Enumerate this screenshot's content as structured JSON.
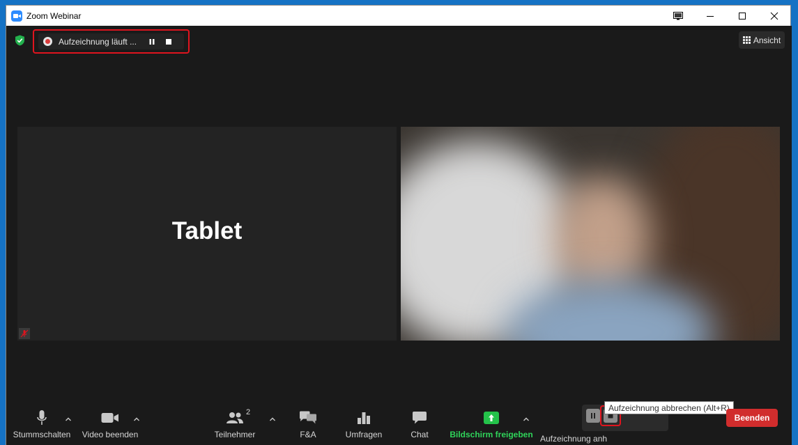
{
  "window": {
    "title": "Zoom Webinar"
  },
  "recording": {
    "status_text": "Aufzeichnung läuft ..."
  },
  "view": {
    "label": "Ansicht"
  },
  "tiles": {
    "left_name": "Tablet"
  },
  "toolbar": {
    "mute_label": "Stummschalten",
    "video_label": "Video beenden",
    "participants_label": "Teilnehmer",
    "participants_count": "2",
    "qa_label": "F&A",
    "polls_label": "Umfragen",
    "chat_label": "Chat",
    "share_label": "Bildschirm freigeben",
    "record_label": "Aufzeichnung anh"
  },
  "tooltip": {
    "text": "Aufzeichnung abbrechen (Alt+R)"
  },
  "end": {
    "label": "Beenden"
  },
  "colors": {
    "accent_blue": "#2d8cff",
    "share_green": "#24c24a",
    "end_red": "#d12d2d",
    "highlight_red": "#e0141e",
    "background": "#1a1a1a"
  },
  "icons": {
    "app": "zoom-camera-icon",
    "security": "shield-check-icon",
    "recording": "record-dot-icon",
    "pause": "pause-icon",
    "stop": "stop-icon",
    "view": "grid-icon",
    "mute_badge": "microphone-muted-icon",
    "mic": "microphone-icon",
    "video": "video-camera-icon",
    "participants": "people-icon",
    "qa": "qa-bubbles-icon",
    "polls": "bar-chart-icon",
    "chat": "chat-bubble-icon",
    "share": "share-arrow-icon"
  }
}
